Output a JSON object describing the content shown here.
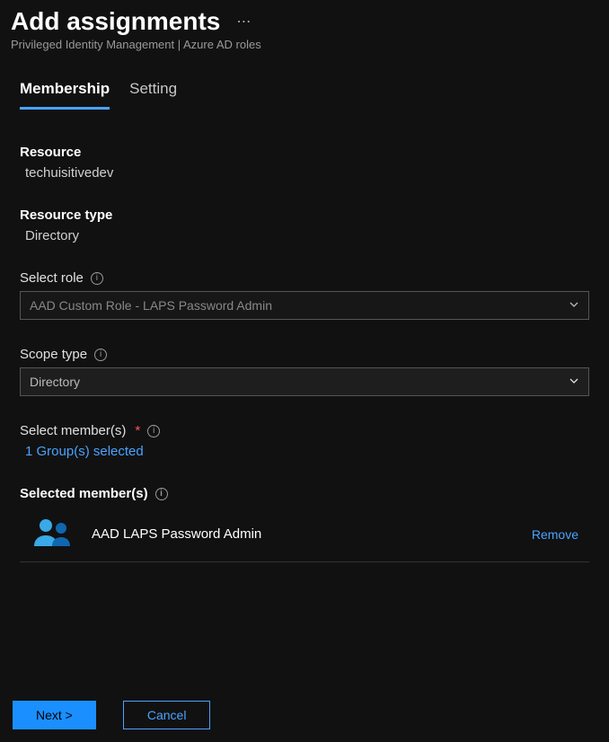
{
  "header": {
    "title": "Add assignments",
    "breadcrumb": "Privileged Identity Management | Azure AD roles"
  },
  "tabs": {
    "membership": "Membership",
    "setting": "Setting"
  },
  "fields": {
    "resource_label": "Resource",
    "resource_value": "techuisitivedev",
    "resource_type_label": "Resource type",
    "resource_type_value": "Directory",
    "select_role_label": "Select role",
    "select_role_value": "AAD Custom Role - LAPS Password Admin",
    "scope_type_label": "Scope type",
    "scope_type_value": "Directory",
    "select_members_label": "Select member(s)",
    "members_selected_link": "1 Group(s) selected",
    "selected_members_label": "Selected member(s)"
  },
  "members": [
    {
      "name": "AAD LAPS Password Admin",
      "remove": "Remove"
    }
  ],
  "footer": {
    "next": "Next >",
    "cancel": "Cancel"
  }
}
